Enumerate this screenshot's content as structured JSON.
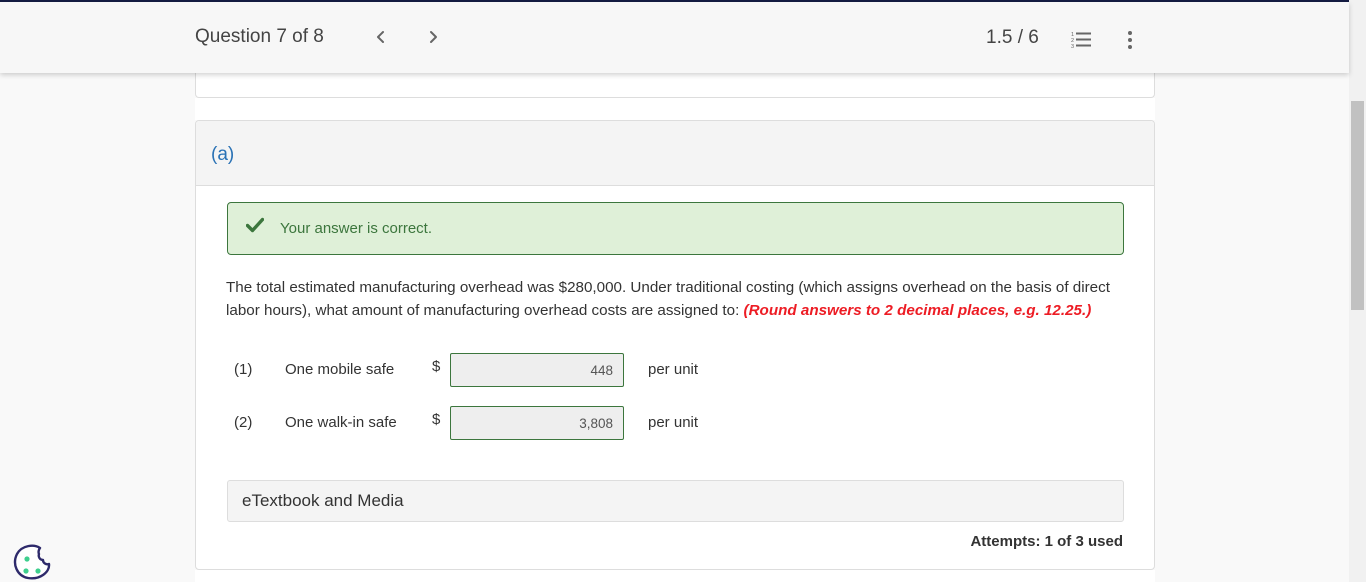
{
  "header": {
    "question_counter": "Question 7 of 8",
    "prev_icon": "chevron-left-icon",
    "next_icon": "chevron-right-icon",
    "score": "1.5 / 6",
    "list_icon": "numbered-list-icon",
    "more_icon": "more-vertical-icon"
  },
  "part": {
    "label": "(a)",
    "feedback": {
      "icon": "checkmark-icon",
      "text": "Your answer is correct.",
      "color": "#3c763d",
      "background": "#dff0d8"
    },
    "prompt": "The total estimated manufacturing overhead was $280,000. Under traditional costing (which assigns overhead on the basis of direct labor hours), what amount of manufacturing overhead costs are assigned to: ",
    "hint": "(Round answers to 2 decimal places, e.g. 12.25.)",
    "hint_color": "#ed1c24",
    "answers": [
      {
        "num": "(1)",
        "label": "One mobile safe",
        "currency": "$",
        "value": "448",
        "unit": "per unit"
      },
      {
        "num": "(2)",
        "label": "One walk-in safe",
        "currency": "$",
        "value": "3,808",
        "unit": "per unit"
      }
    ],
    "etextbook_label": "eTextbook and Media",
    "attempts": "Attempts: 1 of 3 used"
  },
  "cookie_icon": "cookie-icon"
}
